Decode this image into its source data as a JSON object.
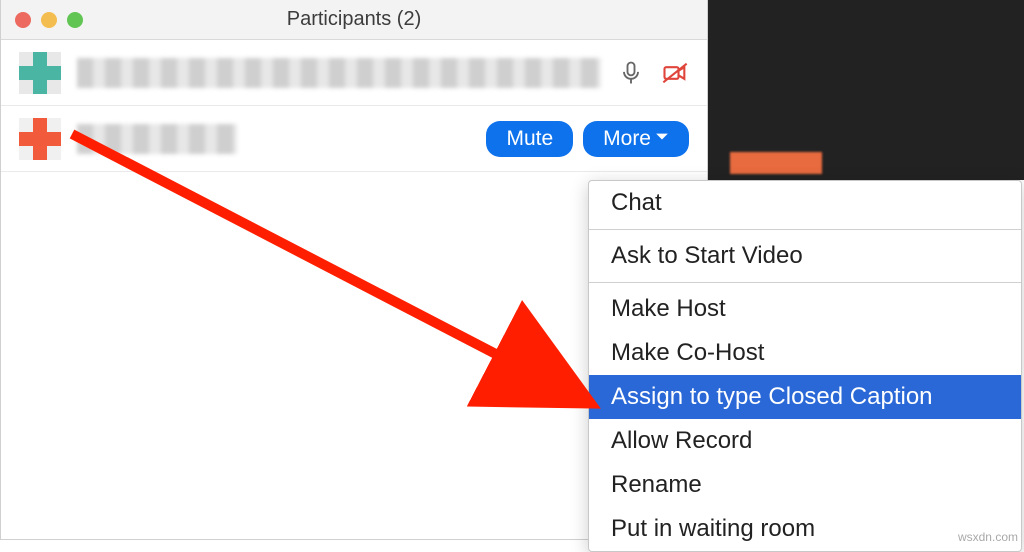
{
  "window": {
    "title": "Participants (2)"
  },
  "participants": [
    {
      "avatar_color": "green",
      "name_redacted": true
    },
    {
      "avatar_color": "orange",
      "name_redacted": true
    }
  ],
  "row_buttons": {
    "mute": "Mute",
    "more": "More"
  },
  "icons": {
    "mic": "microphone-icon",
    "camera_off": "camera-off-icon",
    "chevron_down": "chevron-down-icon"
  },
  "context_menu": {
    "items": [
      {
        "label": "Chat",
        "selected": false
      },
      {
        "label": "Ask to Start Video",
        "selected": false
      },
      {
        "label": "Make Host",
        "selected": false
      },
      {
        "label": "Make Co-Host",
        "selected": false
      },
      {
        "label": "Assign to type Closed Caption",
        "selected": true
      },
      {
        "label": "Allow Record",
        "selected": false
      },
      {
        "label": "Rename",
        "selected": false
      },
      {
        "label": "Put in waiting room",
        "selected": false
      }
    ],
    "separators_after": [
      0,
      1
    ]
  },
  "colors": {
    "accent": "#0e72ec",
    "menu_highlight": "#2a68d7",
    "camera_off": "#e0453b"
  },
  "watermark": "wsxdn.com"
}
